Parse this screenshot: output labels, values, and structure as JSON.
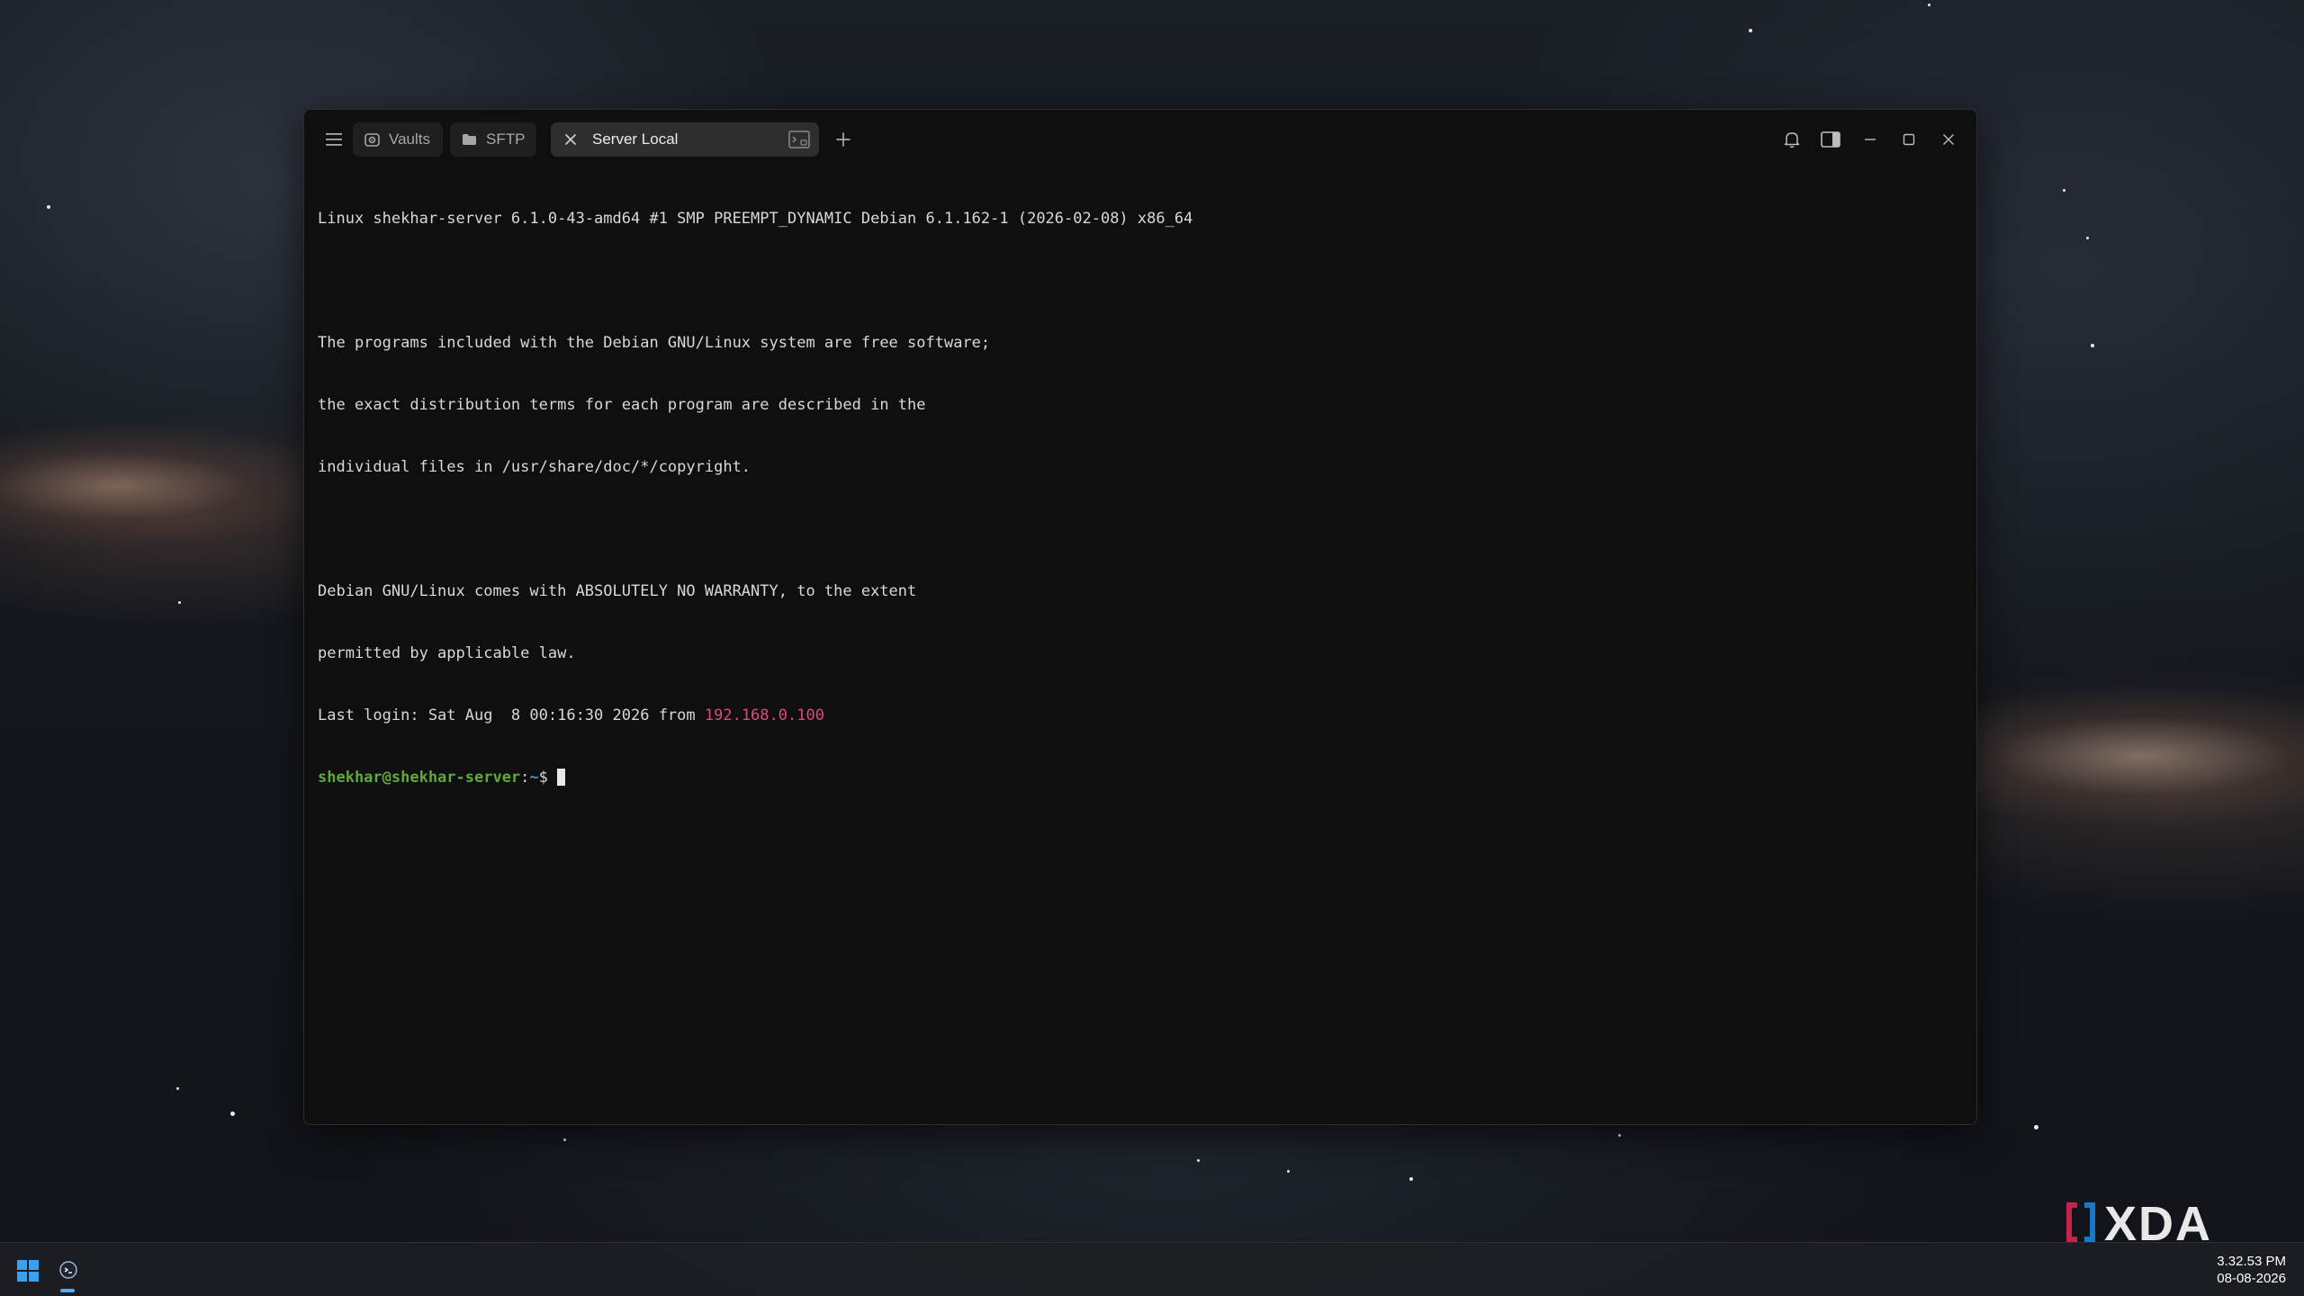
{
  "window": {
    "tabs": [
      {
        "label": "Vaults",
        "icon": "vault-icon"
      },
      {
        "label": "SFTP",
        "icon": "folder-icon"
      },
      {
        "label": "Server Local",
        "icon": "terminal-icon",
        "active": true
      }
    ]
  },
  "terminal": {
    "lines": [
      "Linux shekhar-server 6.1.0-43-amd64 #1 SMP PREEMPT_DYNAMIC Debian 6.1.162-1 (2026-02-08) x86_64",
      "",
      "The programs included with the Debian GNU/Linux system are free software;",
      "the exact distribution terms for each program are described in the",
      "individual files in /usr/share/doc/*/copyright.",
      "",
      "Debian GNU/Linux comes with ABSOLUTELY NO WARRANTY, to the extent",
      "permitted by applicable law."
    ],
    "last_login_prefix": "Last login: Sat Aug  8 00:16:30 2026 from ",
    "last_login_ip": "192.168.0.100",
    "prompt_user": "shekhar@shekhar-server",
    "prompt_sep": ":",
    "prompt_path": "~",
    "prompt_symbol": "$ "
  },
  "taskbar": {
    "time": "3.32.53 PM",
    "date": "08-08-2026"
  },
  "watermark": {
    "text": "XDA"
  },
  "colors": {
    "ip": "#e0487a",
    "prompt_user": "#5fa83a",
    "prompt_path": "#4e8fd9",
    "terminal_bg": "#0f0f0f"
  }
}
